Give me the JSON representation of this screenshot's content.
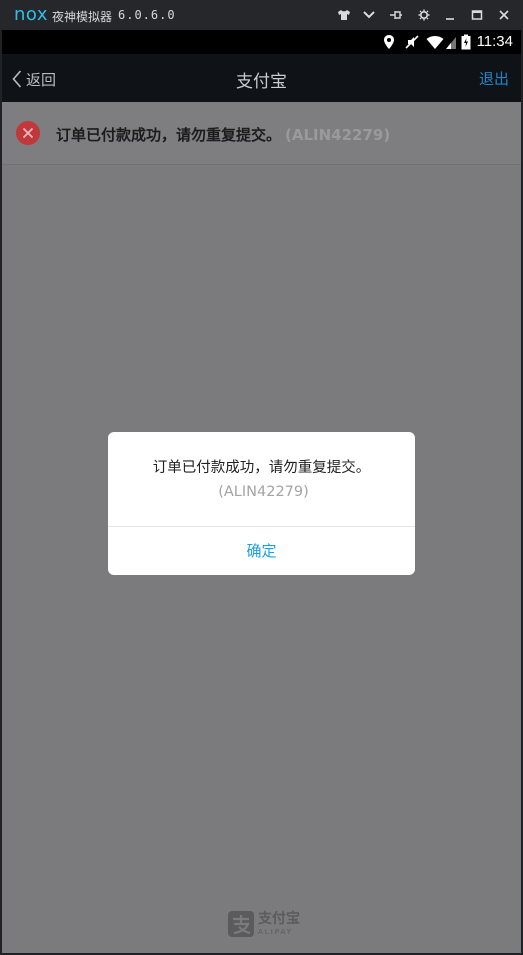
{
  "emulator": {
    "logo": "nox",
    "title": "夜神模拟器",
    "version": "6.0.6.0",
    "controls": [
      "shirt-icon",
      "chevron-down-icon",
      "pin-icon",
      "gear-icon",
      "minimize-icon",
      "maximize-icon",
      "close-icon"
    ]
  },
  "status_bar": {
    "time": "11:34",
    "icons": [
      "location-icon",
      "mute-icon",
      "wifi-icon",
      "signal-icon",
      "battery-icon"
    ]
  },
  "navbar": {
    "back_label": "返回",
    "title": "支付宝",
    "exit_label": "退出"
  },
  "banner": {
    "message": "订单已付款成功，请勿重复提交。",
    "code": "(ALIN42279)"
  },
  "dialog": {
    "message": "订单已付款成功，请勿重复提交。",
    "code": "(ALIN42279)",
    "confirm_label": "确定"
  },
  "footer": {
    "brand": "支付宝",
    "brand_en": "ALIPAY"
  },
  "colors": {
    "accent": "#1aa1e1",
    "exit": "#1d88c7",
    "error": "#c0373c"
  }
}
